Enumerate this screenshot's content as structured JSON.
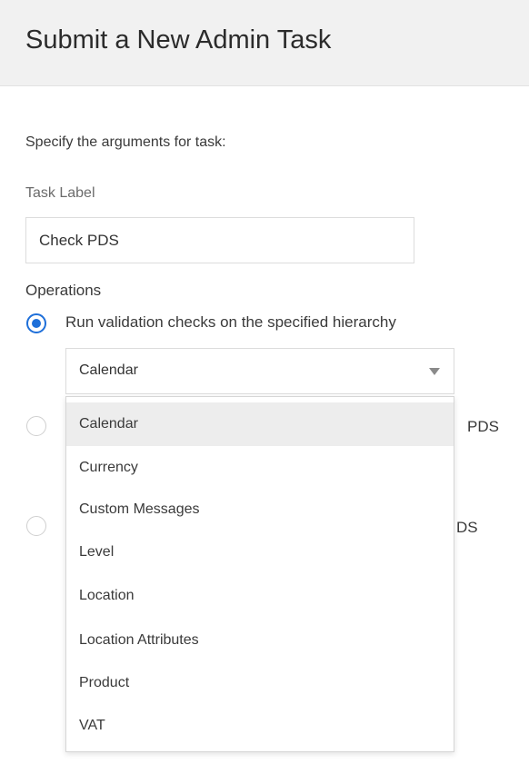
{
  "header": {
    "title": "Submit a New Admin Task"
  },
  "form": {
    "instructions": "Specify the arguments for task:",
    "task_label": {
      "label": "Task Label",
      "value": "Check PDS"
    },
    "operations_label": "Operations",
    "options": [
      {
        "label": "Run validation checks on the specified hierarchy",
        "selected": true
      },
      {
        "label": "PDS",
        "selected": false
      },
      {
        "label": "DS",
        "selected": false
      }
    ],
    "hierarchy_select": {
      "selected": "Calendar",
      "items": [
        "Calendar",
        "Currency",
        "Custom Messages",
        "Level",
        "Location",
        "Location Attributes",
        "Product",
        "VAT"
      ]
    }
  },
  "colors": {
    "accent": "#1e6fd9",
    "header_bg": "#f1f1f1",
    "highlight": "#ededed"
  }
}
